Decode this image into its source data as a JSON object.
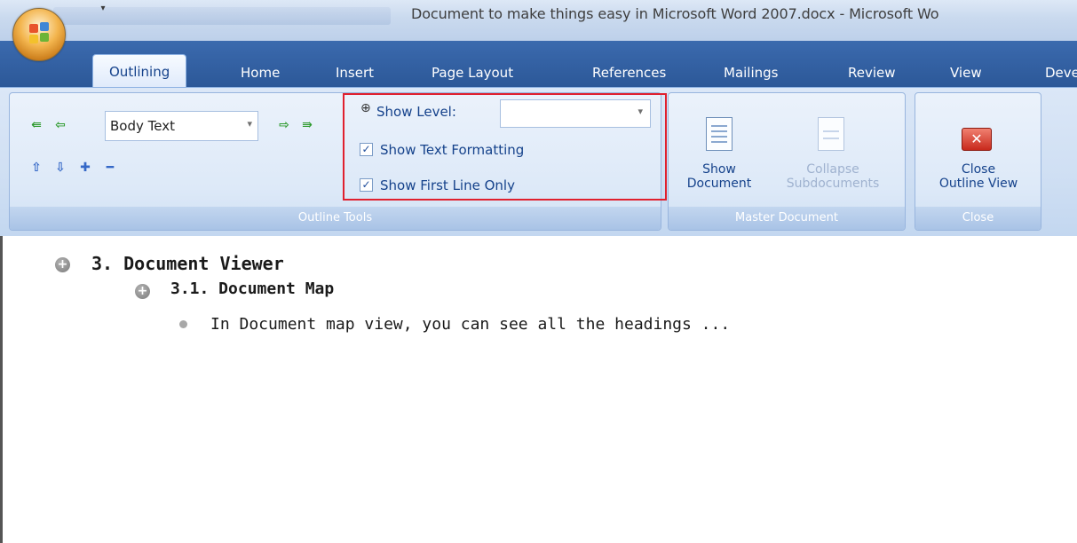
{
  "window": {
    "title": "Document to make things easy in Microsoft Word 2007.docx - Microsoft Wo"
  },
  "tabs": [
    {
      "label": "Outlining",
      "active": true
    },
    {
      "label": "Home"
    },
    {
      "label": "Insert"
    },
    {
      "label": "Page Layout"
    },
    {
      "label": "References"
    },
    {
      "label": "Mailings"
    },
    {
      "label": "Review"
    },
    {
      "label": "View"
    },
    {
      "label": "Deve"
    }
  ],
  "outline_tools": {
    "level_value": "Body Text",
    "show_level_label": "Show Level:",
    "show_level_value": "",
    "show_text_formatting_label": "Show Text Formatting",
    "show_text_formatting_checked": true,
    "show_first_line_only_label": "Show First Line Only",
    "show_first_line_only_checked": true,
    "group_label": "Outline Tools"
  },
  "master_document": {
    "show_document_label": [
      "Show",
      "Document"
    ],
    "collapse_subdocuments_label": [
      "Collapse",
      "Subdocuments"
    ],
    "group_label": "Master Document"
  },
  "close": {
    "close_outline_view_label": [
      "Close",
      "Outline View"
    ],
    "group_label": "Close"
  },
  "outline": [
    {
      "text": "3. Document Viewer",
      "level": 1,
      "marker": "plus"
    },
    {
      "text": "3.1. Document Map",
      "level": 2,
      "marker": "plus"
    },
    {
      "text": "In Document map view, you can see all the headings ...",
      "level": 3,
      "marker": "bullet"
    }
  ]
}
